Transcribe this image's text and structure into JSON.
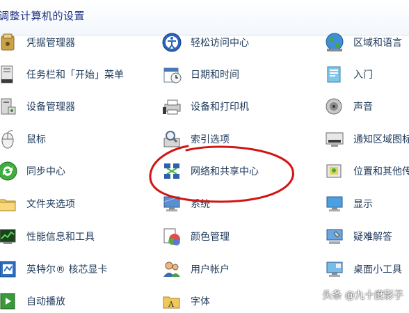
{
  "header": {
    "title": "调整计算机的设置"
  },
  "items": [
    {
      "label": "凭据管理器",
      "icon": "credential-manager-icon"
    },
    {
      "label": "轻松访问中心",
      "icon": "ease-of-access-icon"
    },
    {
      "label": "区域和语言",
      "icon": "region-language-icon"
    },
    {
      "label": "任务栏和「开始」菜单",
      "icon": "taskbar-start-menu-icon"
    },
    {
      "label": "日期和时间",
      "icon": "date-time-icon"
    },
    {
      "label": "入门",
      "icon": "getting-started-icon"
    },
    {
      "label": "设备管理器",
      "icon": "device-manager-icon"
    },
    {
      "label": "设备和打印机",
      "icon": "devices-printers-icon"
    },
    {
      "label": "声音",
      "icon": "sound-icon"
    },
    {
      "label": "鼠标",
      "icon": "mouse-icon"
    },
    {
      "label": "索引选项",
      "icon": "indexing-options-icon"
    },
    {
      "label": "通知区域图标",
      "icon": "notification-area-icon"
    },
    {
      "label": "同步中心",
      "icon": "sync-center-icon"
    },
    {
      "label": "网络和共享中心",
      "icon": "network-sharing-icon"
    },
    {
      "label": "位置和其他传",
      "icon": "location-sensors-icon"
    },
    {
      "label": "文件夹选项",
      "icon": "folder-options-icon"
    },
    {
      "label": "系统",
      "icon": "system-icon"
    },
    {
      "label": "显示",
      "icon": "display-icon"
    },
    {
      "label": "性能信息和工具",
      "icon": "performance-icon"
    },
    {
      "label": "颜色管理",
      "icon": "color-management-icon"
    },
    {
      "label": "疑难解答",
      "icon": "troubleshooting-icon"
    },
    {
      "label": "英特尔® 核芯显卡",
      "icon": "intel-graphics-icon"
    },
    {
      "label": "用户帐户",
      "icon": "user-accounts-icon"
    },
    {
      "label": "桌面小工具",
      "icon": "desktop-gadgets-icon"
    },
    {
      "label": "自动播放",
      "icon": "autoplay-icon"
    },
    {
      "label": "字体",
      "icon": "fonts-icon"
    }
  ],
  "annotation": {
    "color": "#d11414"
  },
  "watermark": {
    "text": "头条 @九十度影子"
  }
}
